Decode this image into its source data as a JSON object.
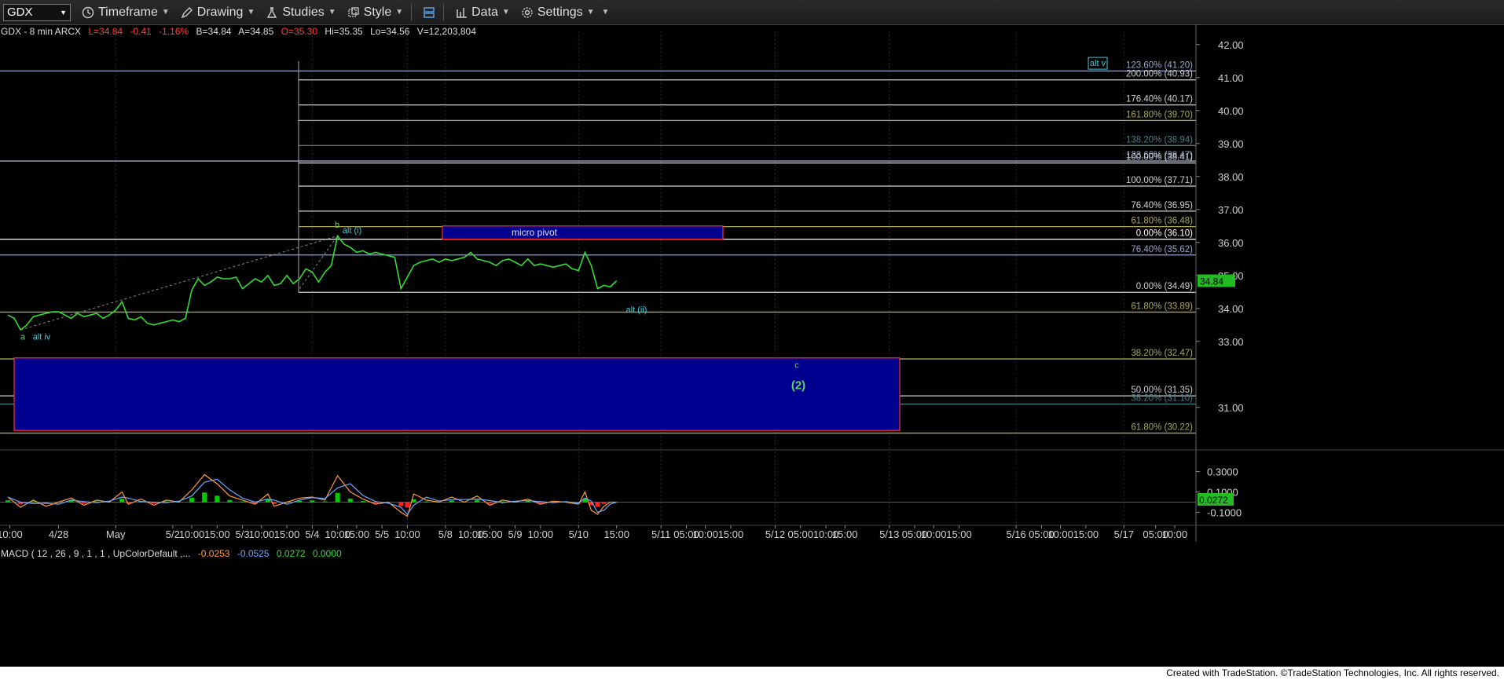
{
  "toolbar": {
    "symbol": "GDX",
    "timeframe": "Timeframe",
    "drawing": "Drawing",
    "studies": "Studies",
    "style": "Style",
    "data": "Data",
    "settings": "Settings"
  },
  "header": {
    "title": "GDX - 8 min  ARCX",
    "last": "L=34.84",
    "chg": "-0.41",
    "pct": "-1.16%",
    "bid": "B=34.84",
    "ask": "A=34.85",
    "open": "O=35.30",
    "hi": "Hi=35.35",
    "lo": "Lo=34.56",
    "vol": "V=12,203,804"
  },
  "macd": {
    "label": "MACD ( 12 , 26 , 9 , 1 , 1 , UpColorDefault ,...",
    "v1": "-0.0253",
    "v2": "-0.0525",
    "v3": "0.0272",
    "v4": "0.0000"
  },
  "footer": "Created with TradeStation. ©TradeStation Technologies, Inc. All rights reserved.",
  "chart_data": {
    "type": "line",
    "symbol": "GDX",
    "interval": "8 min",
    "last_price": "34.84",
    "ylim": [
      29.9,
      42.4
    ],
    "y_ticks": [
      "42.00",
      "41.00",
      "40.00",
      "39.00",
      "38.00",
      "37.00",
      "36.00",
      "35.00",
      "34.00",
      "33.00",
      "31.00"
    ],
    "x_ticks": [
      "10:00",
      "4/28",
      "May",
      "5/2",
      "10:00",
      "15:00",
      "5/3",
      "10:00",
      "15:00",
      "5/4",
      "10:00",
      "15:00",
      "5/5",
      "10:00",
      "5/8",
      "10:00",
      "15:00",
      "5/9",
      "10:00",
      "5/10",
      "15:00",
      "5/11",
      "05:00",
      "10:00",
      "15:00",
      "5/12",
      "05:00",
      "10:00",
      "15:00",
      "5/13",
      "05:00",
      "10:00",
      "15:00",
      "5/16",
      "05:00",
      "10:00",
      "15:00",
      "5/17",
      "05:00",
      "10:00"
    ],
    "x_tick_index": [
      0.3,
      8,
      17,
      26,
      29,
      33,
      37,
      40,
      44,
      48,
      52,
      55,
      59,
      63,
      69,
      73,
      76,
      80,
      84,
      90,
      96,
      103,
      107,
      110,
      114,
      121,
      125,
      129,
      132,
      139,
      143,
      146,
      150,
      159,
      163,
      166,
      170,
      176,
      181,
      184
    ],
    "price_series": [
      [
        0,
        33.8
      ],
      [
        1,
        33.7
      ],
      [
        2,
        33.35
      ],
      [
        3,
        33.5
      ],
      [
        4,
        33.75
      ],
      [
        5,
        33.8
      ],
      [
        6,
        33.85
      ],
      [
        7,
        33.9
      ],
      [
        8,
        33.9
      ],
      [
        9,
        33.8
      ],
      [
        10,
        33.7
      ],
      [
        11,
        33.85
      ],
      [
        12,
        33.75
      ],
      [
        13,
        33.8
      ],
      [
        14,
        33.85
      ],
      [
        15,
        33.7
      ],
      [
        16,
        33.8
      ],
      [
        17,
        33.95
      ],
      [
        18,
        34.2
      ],
      [
        19,
        33.7
      ],
      [
        20,
        33.65
      ],
      [
        21,
        33.75
      ],
      [
        22,
        33.55
      ],
      [
        23,
        33.5
      ],
      [
        24,
        33.55
      ],
      [
        25,
        33.6
      ],
      [
        26,
        33.65
      ],
      [
        27,
        33.6
      ],
      [
        28,
        33.7
      ],
      [
        29,
        34.55
      ],
      [
        30,
        34.9
      ],
      [
        31,
        34.7
      ],
      [
        32,
        34.8
      ],
      [
        33,
        34.95
      ],
      [
        34,
        34.9
      ],
      [
        35,
        34.9
      ],
      [
        36,
        34.95
      ],
      [
        37,
        34.6
      ],
      [
        38,
        34.75
      ],
      [
        39,
        34.9
      ],
      [
        40,
        34.8
      ],
      [
        41,
        35.0
      ],
      [
        42,
        34.7
      ],
      [
        43,
        34.75
      ],
      [
        44,
        35.0
      ],
      [
        45,
        34.75
      ],
      [
        46,
        34.9
      ],
      [
        47,
        35.2
      ],
      [
        48,
        35.1
      ],
      [
        49,
        34.8
      ],
      [
        50,
        35.1
      ],
      [
        51,
        35.3
      ],
      [
        52,
        36.2
      ],
      [
        53,
        35.95
      ],
      [
        54,
        35.85
      ],
      [
        55,
        35.7
      ],
      [
        56,
        35.75
      ],
      [
        57,
        35.65
      ],
      [
        58,
        35.7
      ],
      [
        59,
        35.65
      ],
      [
        60,
        35.6
      ],
      [
        61,
        35.55
      ],
      [
        62,
        34.6
      ],
      [
        63,
        34.95
      ],
      [
        64,
        35.3
      ],
      [
        65,
        35.4
      ],
      [
        66,
        35.45
      ],
      [
        67,
        35.5
      ],
      [
        68,
        35.4
      ],
      [
        69,
        35.5
      ],
      [
        70,
        35.45
      ],
      [
        71,
        35.5
      ],
      [
        72,
        35.55
      ],
      [
        73,
        35.7
      ],
      [
        74,
        35.5
      ],
      [
        75,
        35.45
      ],
      [
        76,
        35.4
      ],
      [
        77,
        35.3
      ],
      [
        78,
        35.45
      ],
      [
        79,
        35.5
      ],
      [
        80,
        35.4
      ],
      [
        81,
        35.3
      ],
      [
        82,
        35.5
      ],
      [
        83,
        35.3
      ],
      [
        84,
        35.35
      ],
      [
        85,
        35.3
      ],
      [
        86,
        35.25
      ],
      [
        87,
        35.3
      ],
      [
        88,
        35.35
      ],
      [
        89,
        35.2
      ],
      [
        90,
        35.15
      ],
      [
        91,
        35.7
      ],
      [
        92,
        35.3
      ],
      [
        93,
        34.6
      ],
      [
        94,
        34.7
      ],
      [
        95,
        34.65
      ],
      [
        96,
        34.84
      ]
    ],
    "macd_ylim": [
      -0.22,
      0.42
    ],
    "macd_ticks": [
      "0.3000",
      "0.1000",
      "-0.1000"
    ],
    "macd_last": "0.0272",
    "macd_series": [
      [
        0,
        0.05
      ],
      [
        2,
        -0.05
      ],
      [
        4,
        0.02
      ],
      [
        6,
        -0.04
      ],
      [
        8,
        0.0
      ],
      [
        10,
        0.04
      ],
      [
        12,
        -0.03
      ],
      [
        14,
        0.02
      ],
      [
        16,
        0.0
      ],
      [
        18,
        0.1
      ],
      [
        19,
        -0.02
      ],
      [
        21,
        0.03
      ],
      [
        23,
        -0.03
      ],
      [
        25,
        0.02
      ],
      [
        27,
        0.0
      ],
      [
        29,
        0.12
      ],
      [
        31,
        0.27
      ],
      [
        33,
        0.18
      ],
      [
        35,
        0.06
      ],
      [
        37,
        0.02
      ],
      [
        39,
        -0.02
      ],
      [
        41,
        0.08
      ],
      [
        42,
        -0.04
      ],
      [
        44,
        0.0
      ],
      [
        46,
        0.04
      ],
      [
        48,
        0.05
      ],
      [
        50,
        0.02
      ],
      [
        52,
        0.26
      ],
      [
        54,
        0.1
      ],
      [
        56,
        0.03
      ],
      [
        58,
        -0.02
      ],
      [
        60,
        0.0
      ],
      [
        62,
        -0.1
      ],
      [
        63,
        -0.14
      ],
      [
        64,
        0.08
      ],
      [
        66,
        0.02
      ],
      [
        68,
        0.0
      ],
      [
        70,
        0.05
      ],
      [
        72,
        0.0
      ],
      [
        74,
        0.06
      ],
      [
        76,
        -0.03
      ],
      [
        78,
        0.02
      ],
      [
        80,
        0.0
      ],
      [
        82,
        0.03
      ],
      [
        84,
        -0.02
      ],
      [
        86,
        0.01
      ],
      [
        88,
        0.0
      ],
      [
        90,
        -0.02
      ],
      [
        91,
        0.1
      ],
      [
        92,
        -0.08
      ],
      [
        93,
        -0.12
      ],
      [
        94,
        -0.04
      ],
      [
        95,
        0.0
      ],
      [
        96,
        0.0
      ]
    ],
    "fib_levels": [
      {
        "label": "123.60% (41.20)",
        "value": 41.2,
        "x0": 0,
        "color": "#9aa6c8"
      },
      {
        "label": "200.00% (40.93)",
        "value": 40.93,
        "x0": 380,
        "color": "#d0d0d0"
      },
      {
        "label": "176.40% (40.17)",
        "value": 40.17,
        "x0": 380,
        "color": "#d0d0d0"
      },
      {
        "label": "161.80% (39.70)",
        "value": 39.7,
        "x0": 380,
        "color": "#a8a860"
      },
      {
        "label": "138.20% (38.94)",
        "value": 38.94,
        "x0": 380,
        "color": "#4a7f86"
      },
      {
        "label": "123.60% (38.47)",
        "value": 38.47,
        "x0": 0,
        "color": "#9aa6c8"
      },
      {
        "label": "100.00% (38.41)",
        "value": 38.41,
        "x0": 380,
        "color": "#d0d0d0"
      },
      {
        "label": "100.00% (37.71)",
        "value": 37.71,
        "x0": 380,
        "color": "#d0d0d0"
      },
      {
        "label": "76.40% (36.95)",
        "value": 36.95,
        "x0": 380,
        "color": "#d0d0d0"
      },
      {
        "label": "61.80% (36.48)",
        "value": 36.48,
        "x0": 380,
        "color": "#a8a860"
      },
      {
        "label": "0.00% (36.10)",
        "value": 36.1,
        "x0": 0,
        "color": "#ffffff"
      },
      {
        "label": "76.40% (35.62)",
        "value": 35.62,
        "x0": 0,
        "color": "#9aa6c8"
      },
      {
        "label": "0.00% (34.49)",
        "value": 34.49,
        "x0": 380,
        "color": "#d0d0d0"
      },
      {
        "label": "61.80% (33.89)",
        "value": 33.89,
        "x0": 0,
        "color": "#a8a860"
      },
      {
        "label": "38.20% (32.47)",
        "value": 32.47,
        "x0": 0,
        "color": "#a8a860"
      },
      {
        "label": "50.00% (31.35)",
        "value": 31.35,
        "x0": 0,
        "color": "#d0d0d0"
      },
      {
        "label": "38.20% (31.10)",
        "value": 31.1,
        "x0": 0,
        "color": "#4a7f86"
      },
      {
        "label": "61.80% (30.22)",
        "value": 30.22,
        "x0": 0,
        "color": "#a8a860"
      }
    ],
    "zones": [
      {
        "label": "micro pivot",
        "from": 36.1,
        "to": 36.5
      },
      {
        "label": "",
        "from": 30.3,
        "to": 32.5
      }
    ],
    "wave_labels": [
      {
        "text": "a",
        "color": "#5fd35f"
      },
      {
        "text": "alt iv",
        "color": "#48c8d8"
      },
      {
        "text": "b",
        "color": "#5fd35f"
      },
      {
        "text": "alt (i)",
        "color": "#48c8d8"
      },
      {
        "text": "alt (ii)",
        "color": "#48c8d8"
      },
      {
        "text": "c",
        "color": "#5fd35f"
      },
      {
        "text": "(2)",
        "color": "#5fd35f"
      },
      {
        "text": "alt v",
        "color": "#48c8d8"
      }
    ],
    "colors": {
      "price": "#33dd33",
      "macd_up": "#00cc00",
      "macd_down": "#ff2020",
      "zone_fill": "#000090",
      "zone_border": "#ff3030",
      "axis_text": "#d0d0d0"
    }
  }
}
